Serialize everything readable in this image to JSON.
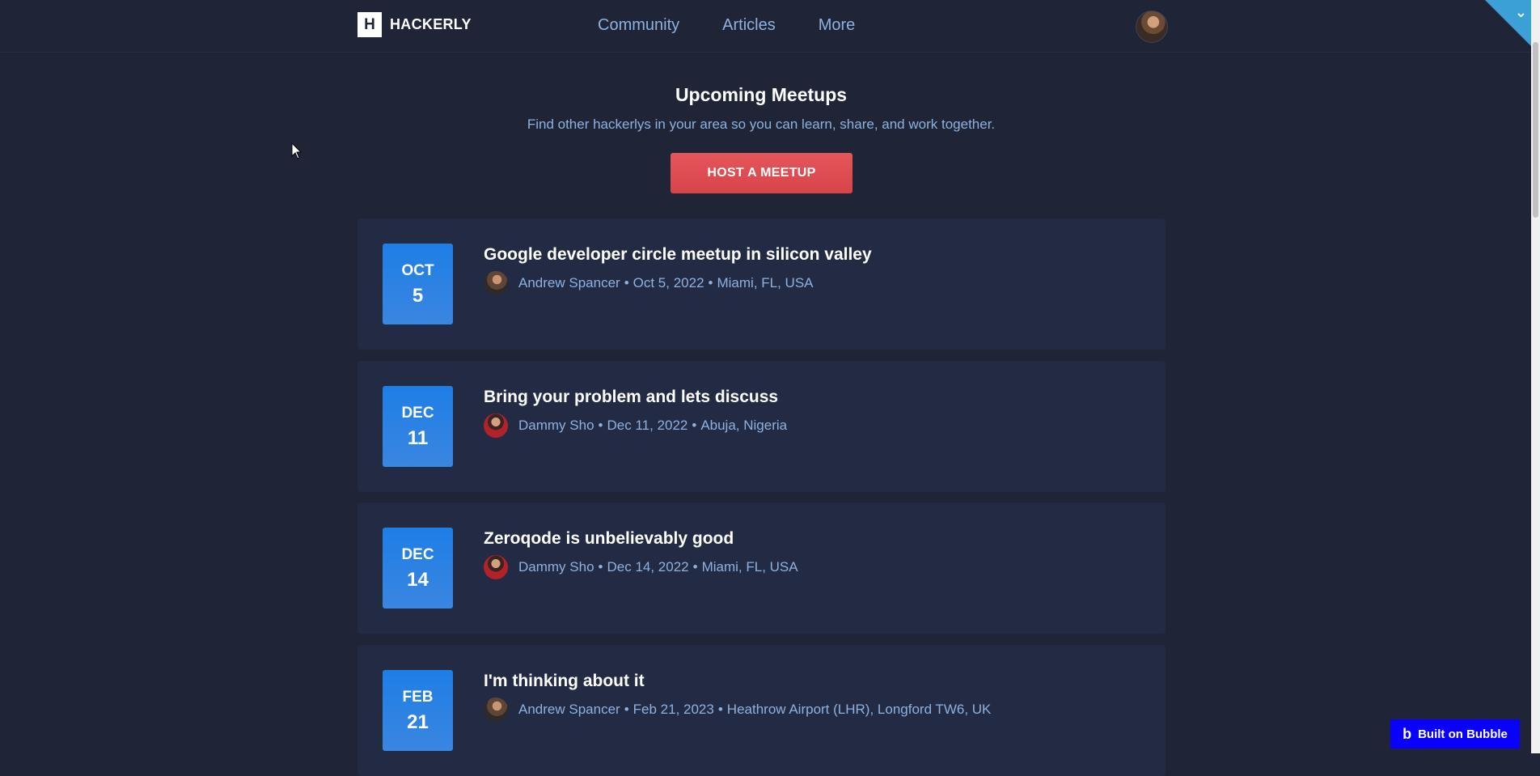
{
  "header": {
    "logo_letter": "H",
    "logo_text": "HACKERLY",
    "nav": [
      "Community",
      "Articles",
      "More"
    ]
  },
  "hero": {
    "title": "Upcoming Meetups",
    "subtitle": "Find other hackerlys in your area so you can learn, share, and work together.",
    "host_button": "HOST A MEETUP"
  },
  "meetups": [
    {
      "month": "OCT",
      "day": "5",
      "title": "Google developer circle meetup in silicon valley",
      "author": "Andrew Spancer",
      "date": "Oct 5, 2022",
      "location": "Miami, FL, USA"
    },
    {
      "month": "DEC",
      "day": "11",
      "title": "Bring your problem and lets discuss",
      "author": "Dammy Sho",
      "date": "Dec 11, 2022",
      "location": "Abuja, Nigeria"
    },
    {
      "month": "DEC",
      "day": "14",
      "title": "Zeroqode is unbelievably good",
      "author": "Dammy Sho",
      "date": "Dec 14, 2022",
      "location": "Miami, FL, USA"
    },
    {
      "month": "FEB",
      "day": "21",
      "title": "I'm thinking about it",
      "author": "Andrew Spancer",
      "date": "Feb 21, 2023",
      "location": "Heathrow Airport (LHR), Longford TW6, UK"
    }
  ],
  "badge": {
    "label": "Built on Bubble"
  },
  "colors": {
    "background": "#1f2537",
    "card": "#232b44",
    "accent_blue": "#1e7ee6",
    "link_blue": "#8eb1e0",
    "button_red": "#e04c51",
    "bubble_blue": "#0a00ff"
  }
}
